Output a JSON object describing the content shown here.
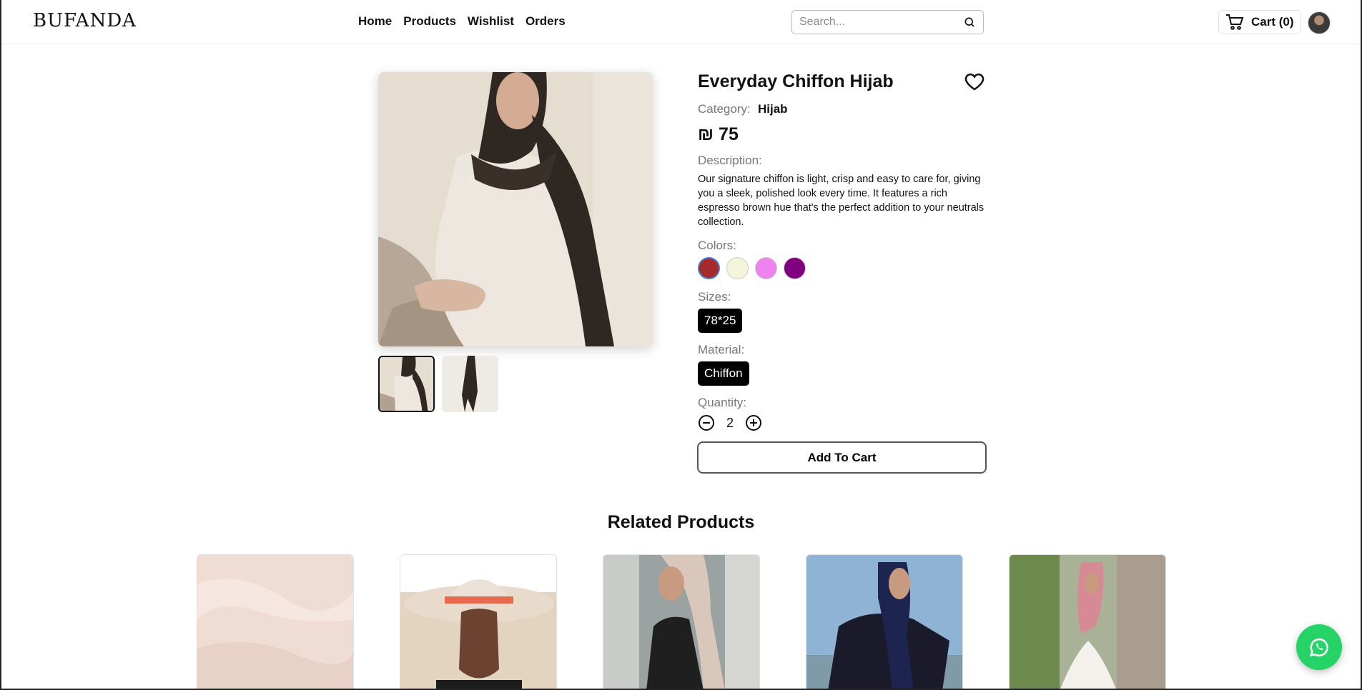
{
  "header": {
    "logo": "BUFANDA",
    "nav": [
      "Home",
      "Products",
      "Wishlist",
      "Orders"
    ],
    "search_placeholder": "Search...",
    "cart_label": "Cart (0)"
  },
  "product": {
    "title": "Everyday Chiffon Hijab",
    "category_label": "Category:",
    "category": "Hijab",
    "price": "₪ 75",
    "description_label": "Description:",
    "description": "Our signature chiffon is light, crisp and easy to care for, giving you a sleek, polished look every time. It features a rich espresso brown hue that's the perfect addition to your neutrals collection.",
    "colors_label": "Colors:",
    "colors": [
      "#a52a2a",
      "#f5f5dc",
      "#ee82ee",
      "#800080"
    ],
    "selected_color_index": 0,
    "sizes_label": "Sizes:",
    "sizes": [
      "78*25"
    ],
    "material_label": "Material:",
    "materials": [
      "Chiffon"
    ],
    "quantity_label": "Quantity:",
    "quantity": "2",
    "add_to_cart": "Add To Cart"
  },
  "related": {
    "title": "Related Products"
  },
  "icons": {
    "search": "search-icon",
    "cart": "cart-icon",
    "heart": "heart-icon",
    "minus": "minus-circle-icon",
    "plus": "plus-circle-icon",
    "whatsapp": "whatsapp-icon"
  }
}
